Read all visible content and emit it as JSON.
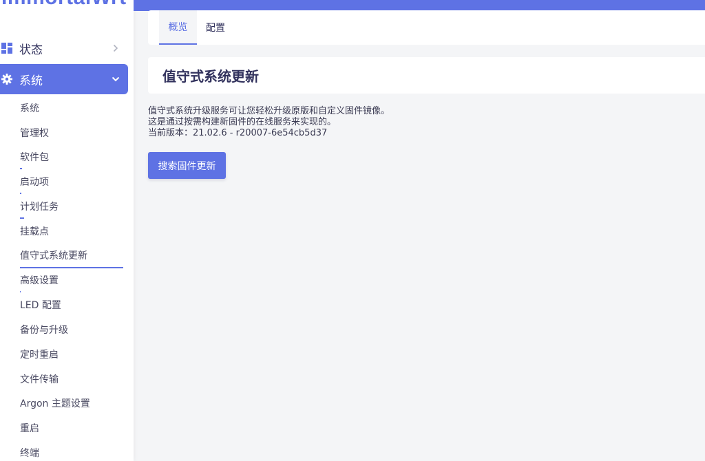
{
  "brand": {
    "logo_text": "ImmortalWrt",
    "accent_color": "#5e72e4"
  },
  "sidebar": {
    "status": {
      "label": "状态",
      "icon": "dashboard-icon"
    },
    "system": {
      "label": "系统",
      "icon": "gear-icon"
    },
    "sub_items": [
      {
        "label": "系统"
      },
      {
        "label": "管理权"
      },
      {
        "label": "软件包"
      },
      {
        "label": "启动项"
      },
      {
        "label": "计划任务"
      },
      {
        "label": "挂载点"
      },
      {
        "label": "值守式系统更新",
        "active": true
      },
      {
        "label": "高级设置"
      },
      {
        "label": "LED 配置"
      },
      {
        "label": "备份与升级"
      },
      {
        "label": "定时重启"
      },
      {
        "label": "文件传输"
      },
      {
        "label": "Argon 主题设置"
      },
      {
        "label": "重启"
      },
      {
        "label": "终端"
      }
    ]
  },
  "tabs": [
    {
      "label": "概览",
      "active": true
    },
    {
      "label": "配置",
      "active": false
    }
  ],
  "page": {
    "title": "值守式系统更新",
    "description_line1": "值守式系统升级服务可让您轻松升级原版和自定义固件镜像。",
    "description_line2": "这是通过按需构建新固件的在线服务来实现的。",
    "current_version": "当前版本：21.02.6 - r20007-6e54cb5d37",
    "search_button": "搜索固件更新"
  }
}
